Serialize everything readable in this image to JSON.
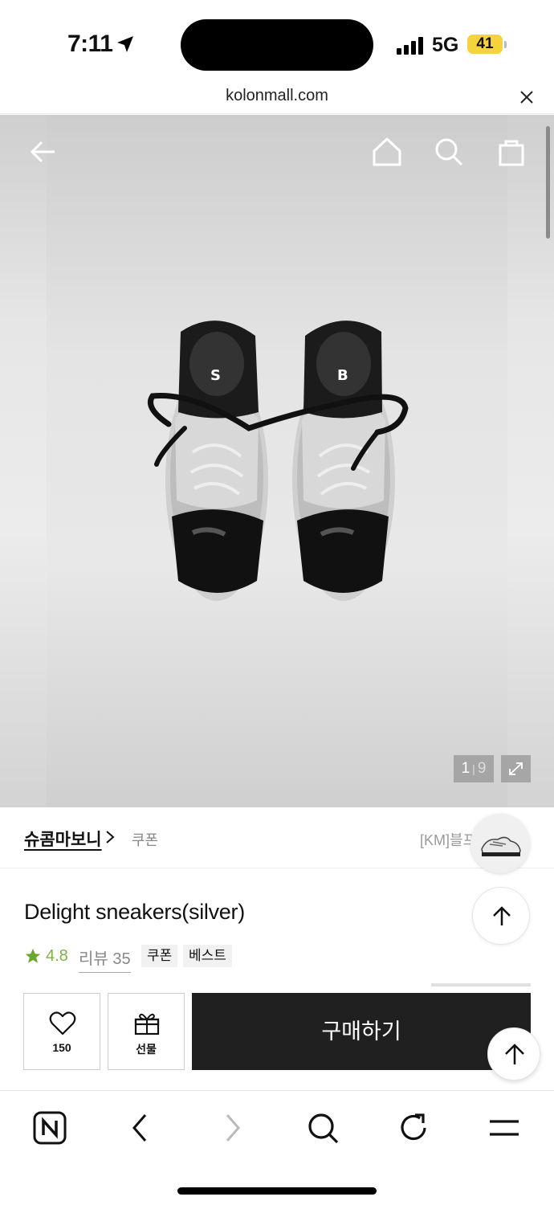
{
  "status_bar": {
    "time": "7:11",
    "network": "5G",
    "battery": "41"
  },
  "browser": {
    "url": "kolonmall.com"
  },
  "gallery": {
    "current": "1",
    "total": "9"
  },
  "brand": {
    "name": "슈콤마보니",
    "coupon_label": "쿠폰",
    "promo_text": "[KM]블프"
  },
  "product": {
    "title": "Delight sneakers(silver)",
    "rating": "4.8",
    "review_label": "리뷰 35",
    "tags": [
      "쿠폰",
      "베스트"
    ]
  },
  "actions": {
    "like_count": "150",
    "gift_label": "선물",
    "buy_label": "구매하기"
  },
  "colors": {
    "buy_button": "#202020",
    "rating_green": "#7cb342",
    "battery_yellow": "#f6d33c"
  }
}
